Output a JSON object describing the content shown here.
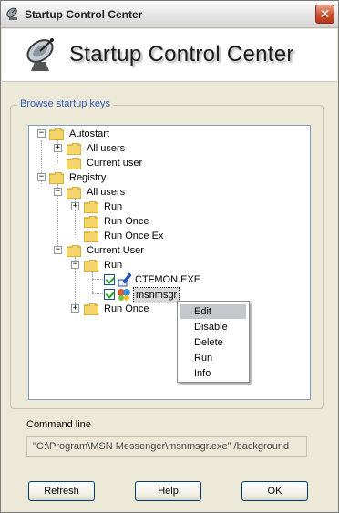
{
  "window": {
    "title": "Startup Control Center"
  },
  "titlebar": {
    "close_label": "✕"
  },
  "banner": {
    "title": "Startup Control Center"
  },
  "browse": {
    "group_label": "Browse startup keys",
    "tree": {
      "autostart": "Autostart",
      "autostart_all_users": "All users",
      "autostart_current_user": "Current user",
      "registry": "Registry",
      "registry_all_users": "All users",
      "all_run": "Run",
      "all_run_once": "Run Once",
      "all_run_once_ex": "Run Once Ex",
      "registry_current_user": "Current User",
      "cu_run": "Run",
      "ctfmon": "CTFMON.EXE",
      "msnmsgr": "msnmsgr",
      "cu_run_once": "Run Once"
    }
  },
  "context_menu": {
    "items": [
      {
        "label": "Edit",
        "highlighted": true
      },
      {
        "label": "Disable"
      },
      {
        "label": "Delete"
      },
      {
        "label": "Run"
      },
      {
        "label": "Info"
      }
    ]
  },
  "command_line": {
    "label": "Command line",
    "value": "\"C:\\Program\\MSN Messenger\\msnmsgr.exe\" /background"
  },
  "buttons": {
    "refresh": "Refresh",
    "help": "Help",
    "ok": "OK"
  },
  "colors": {
    "group_label": "#2f5bb7",
    "folder": "#f5d469",
    "close_button": "#c8502d"
  },
  "icons": {
    "app": "satellite-dish-icon",
    "folder": "folder-icon",
    "exe": "pen-icon",
    "msn": "msn-butterfly-icon"
  }
}
